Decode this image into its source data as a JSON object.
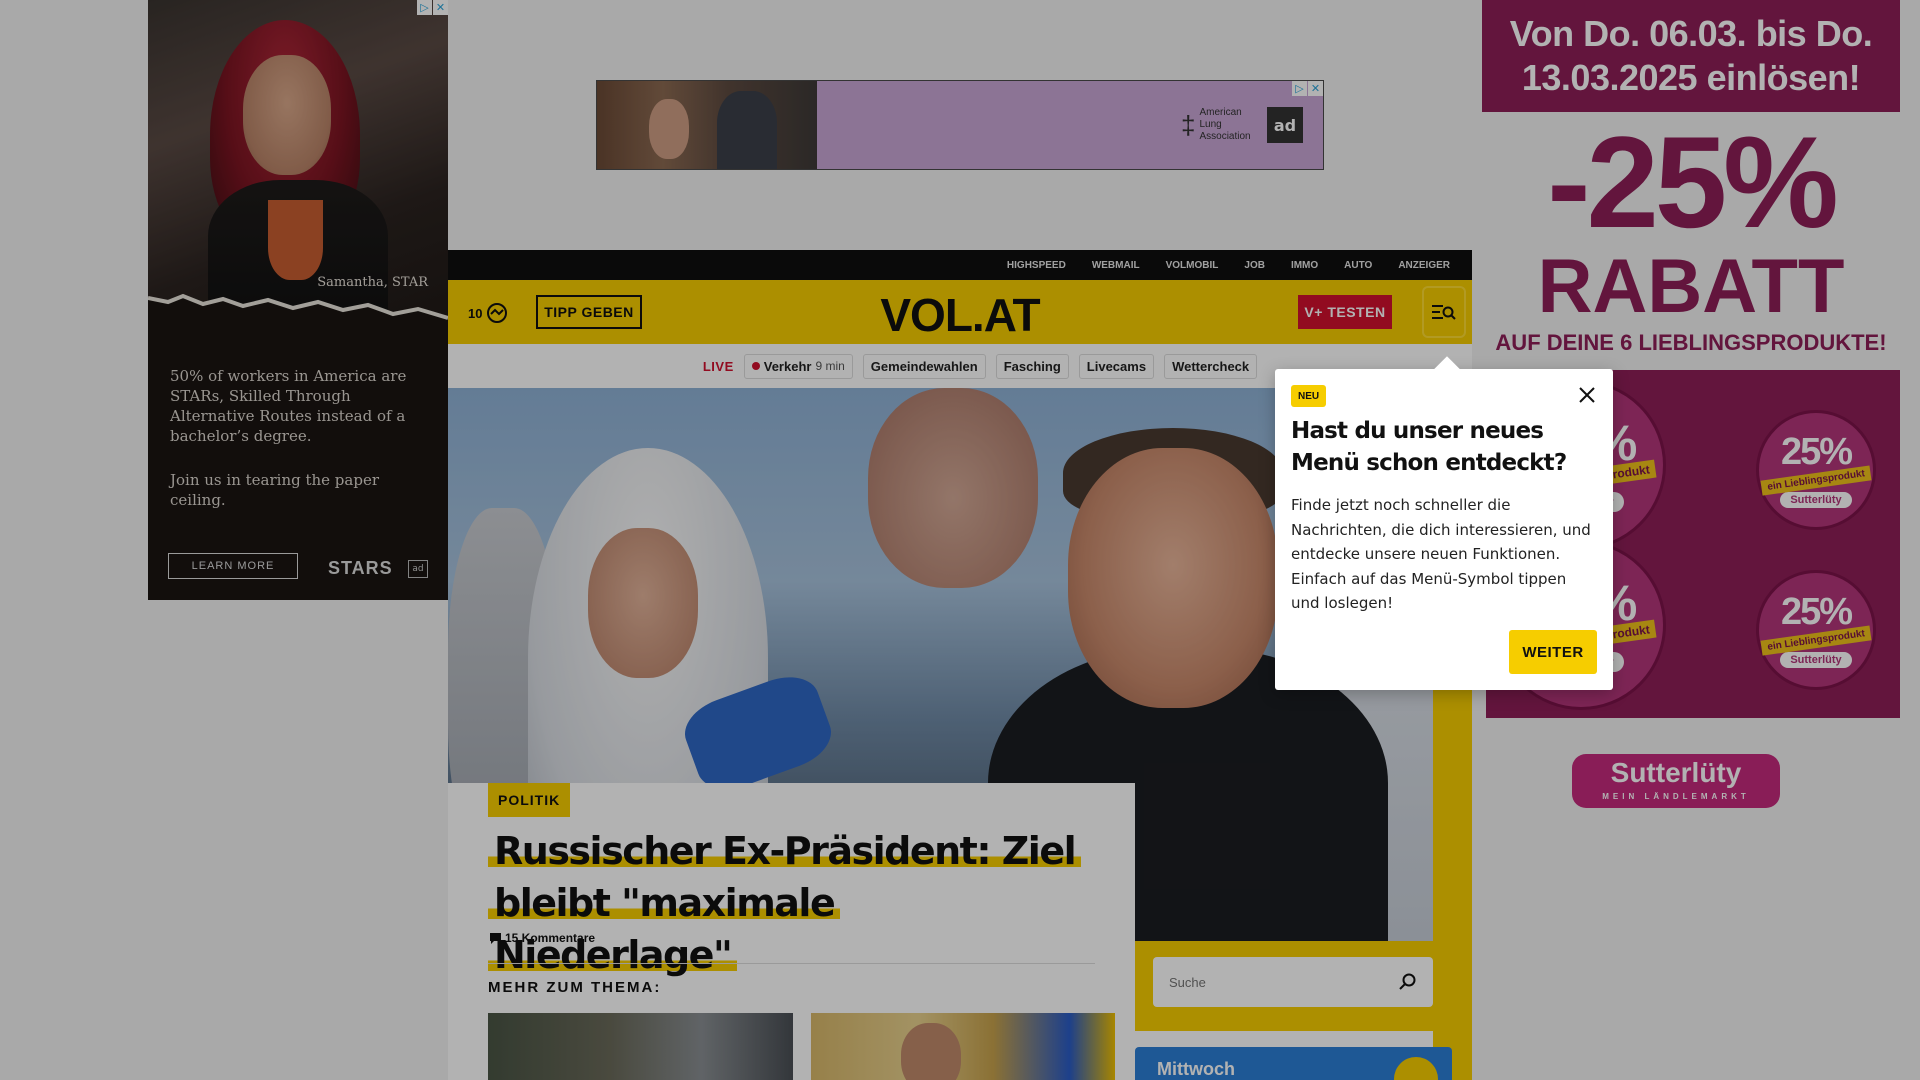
{
  "ads": {
    "left": {
      "caption": "Samantha, STAR",
      "copy": "50% of workers in America are STARs, Skilled Through Alternative Routes instead of a bachelor’s degree.",
      "copy2": "Join us in tearing the paper ceiling.",
      "cta": "LEARN MORE",
      "brand": "STARS",
      "adcouncil": "ad"
    },
    "top": {
      "org": "American Lung Association",
      "adcouncil": "ad"
    },
    "right": {
      "headline": "Von Do. 06.03. bis Do. 13.03.2025 einlösen!",
      "percent": "-25%",
      "rabatt": "RABATT",
      "subline": "AUF DEINE 6 LIEBLINGSPRODUKTE!",
      "sticker_percent": "-25%",
      "sticker_percent_small": "25%",
      "sticker_band": "auf ein Lieblingsprodukt",
      "sticker_band_small": "ein Lieblingsprodukt",
      "sticker_logo": "Sutterlüty",
      "brand": "Sutterlüty",
      "brand_tagline": "MEIN LÄNDLEMARKT"
    }
  },
  "topbar": {
    "links": [
      "HIGHSPEED",
      "WEBMAIL",
      "VOLMOBIL",
      "JOB",
      "IMMO",
      "AUTO",
      "ANZEIGER"
    ]
  },
  "header": {
    "temperature": "10",
    "tipp_label": "TIPP GEBEN",
    "logo": "VOL.AT",
    "vplus_label": "V+ TESTEN"
  },
  "subnav": {
    "live_label": "LIVE",
    "traffic_label": "Verkehr",
    "traffic_time": "9 min",
    "chips": [
      "Gemeindewahlen",
      "Fasching",
      "Livecams",
      "Wettercheck"
    ]
  },
  "article": {
    "category": "POLITIK",
    "headline": "Russischer Ex-Präsident: Ziel bleibt \"maximale Niederlage\"",
    "comments": "15 Kommentare",
    "more_heading": "MEHR ZUM THEMA:"
  },
  "sidebar": {
    "search_placeholder": "Suche",
    "weather_day": "Mittwoch"
  },
  "popover": {
    "badge": "NEU",
    "title": "Hast du unser neues Menü schon entdeckt?",
    "body": "Finde jetzt noch schneller die Nachrichten, die dich interessieren, und entdecke unsere neuen Funktionen. Einfach auf das Menü-Symbol tippen und loslegen!",
    "button": "WEITER"
  },
  "colors": {
    "brand_yellow": "#f6cd00",
    "accent_red": "#d2112e",
    "ad_magenta": "#8f1f58"
  }
}
